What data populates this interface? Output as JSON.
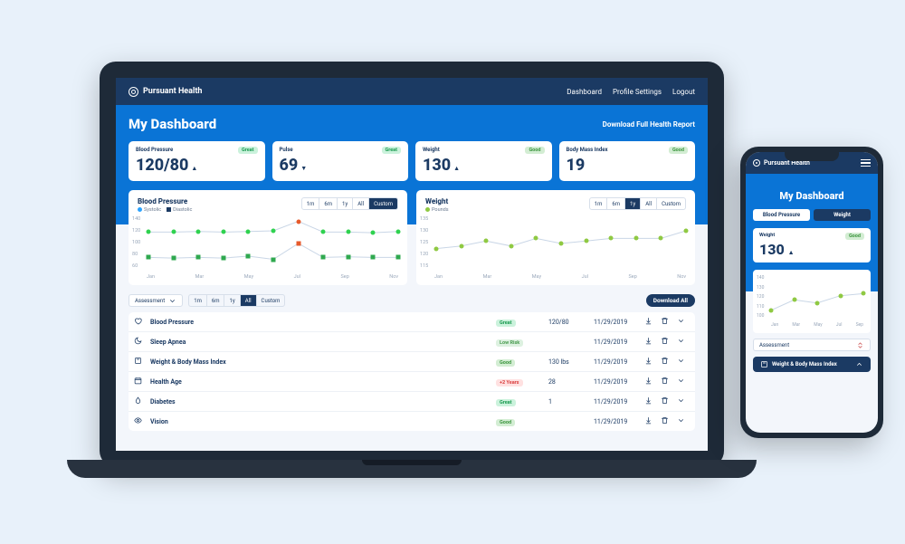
{
  "brand": "Pursuant Health",
  "nav": {
    "dashboard": "Dashboard",
    "profile": "Profile Settings",
    "logout": "Logout"
  },
  "hero": {
    "title": "My Dashboard",
    "download_full": "Download Full Health Report"
  },
  "stats": {
    "bp": {
      "label": "Blood Pressure",
      "badge": "Great",
      "value": "120/80",
      "trend": "▲"
    },
    "pulse": {
      "label": "Pulse",
      "badge": "Great",
      "value": "69",
      "trend": "▼"
    },
    "weight": {
      "label": "Weight",
      "badge": "Good",
      "value": "130",
      "trend": "▲"
    },
    "bmi": {
      "label": "Body Mass Index",
      "badge": "Good",
      "value": "19",
      "trend": ""
    }
  },
  "charts": {
    "ranges": [
      "1m",
      "6m",
      "1y",
      "All",
      "Custom"
    ],
    "bp": {
      "title": "Blood Pressure",
      "legend": {
        "systolic": "Systolic",
        "diastolic": "Diastolic"
      },
      "active_range": "Custom",
      "x": [
        "Jan",
        "Mar",
        "May",
        "Jul",
        "Sep",
        "Nov"
      ]
    },
    "weight": {
      "title": "Weight",
      "legend": {
        "pounds": "Pounds"
      },
      "active_range": "1y",
      "x": [
        "Jan",
        "Mar",
        "May",
        "Jul",
        "Sep",
        "Nov"
      ]
    }
  },
  "chart_data": [
    {
      "type": "line",
      "title": "Blood Pressure",
      "xlabel": "",
      "ylabel": "",
      "ylim": [
        60,
        140
      ],
      "categories": [
        "Jan",
        "Feb",
        "Mar",
        "Apr",
        "May",
        "Jun",
        "Jul",
        "Aug",
        "Sep",
        "Oct",
        "Nov"
      ],
      "series": [
        {
          "name": "Systolic",
          "values": [
            118,
            118,
            119,
            118,
            119,
            120,
            135,
            118,
            118,
            117,
            119
          ]
        },
        {
          "name": "Diastolic",
          "values": [
            78,
            77,
            78,
            77,
            80,
            75,
            100,
            78,
            79,
            78,
            78
          ]
        }
      ],
      "outliers": {
        "month": "Jul",
        "systolic": 135,
        "diastolic": 100
      }
    },
    {
      "type": "line",
      "title": "Weight",
      "xlabel": "",
      "ylabel": "",
      "ylim": [
        115,
        135
      ],
      "categories": [
        "Jan",
        "Feb",
        "Mar",
        "Apr",
        "May",
        "Jun",
        "Jul",
        "Aug",
        "Sep",
        "Oct",
        "Nov"
      ],
      "series": [
        {
          "name": "Pounds",
          "values": [
            123,
            124,
            126,
            124,
            127,
            125,
            126,
            127,
            127,
            127,
            130
          ]
        }
      ]
    },
    {
      "type": "line",
      "title": "Weight (mobile)",
      "xlabel": "",
      "ylabel": "",
      "ylim": [
        100,
        140
      ],
      "categories": [
        "Jan",
        "Mar",
        "May",
        "Jul",
        "Sep"
      ],
      "series": [
        {
          "name": "Pounds",
          "values": [
            108,
            118,
            115,
            122,
            124
          ]
        }
      ]
    }
  ],
  "assessment": {
    "dropdown_label": "Assessment",
    "ranges": [
      "1m",
      "6m",
      "1y",
      "All",
      "Custom"
    ],
    "active_range": "All",
    "download_all": "Download All",
    "rows": [
      {
        "icon": "heart",
        "name": "Blood Pressure",
        "badge": "Great",
        "value": "120/80",
        "date": "11/29/2019"
      },
      {
        "icon": "moon",
        "name": "Sleep Apnea",
        "badge": "Low Risk",
        "value": "",
        "date": "11/29/2019"
      },
      {
        "icon": "scale",
        "name": "Weight & Body Mass Index",
        "badge": "Good",
        "value": "130 lbs",
        "date": "11/29/2019"
      },
      {
        "icon": "calendar",
        "name": "Health Age",
        "badge": "+2 Years",
        "value": "28",
        "date": "11/29/2019"
      },
      {
        "icon": "droplet",
        "name": "Diabetes",
        "badge": "Great",
        "value": "1",
        "date": "11/29/2019"
      },
      {
        "icon": "eye",
        "name": "Vision",
        "badge": "Good",
        "value": "",
        "date": "11/29/2019"
      }
    ]
  },
  "mobile": {
    "tabs": {
      "bp": "Blood Pressure",
      "weight": "Weight"
    },
    "weight_card": {
      "label": "Weight",
      "badge": "Good",
      "value": "130",
      "trend": "▲"
    },
    "category_row": "Weight & Body Mass Index",
    "assessment_select": "Assessment"
  },
  "colors": {
    "systolic": "#2aa3ff",
    "diastolic": "#1b3a63",
    "good": "#8fc942",
    "great": "#8fc942",
    "outlier": "#e75a2b"
  }
}
